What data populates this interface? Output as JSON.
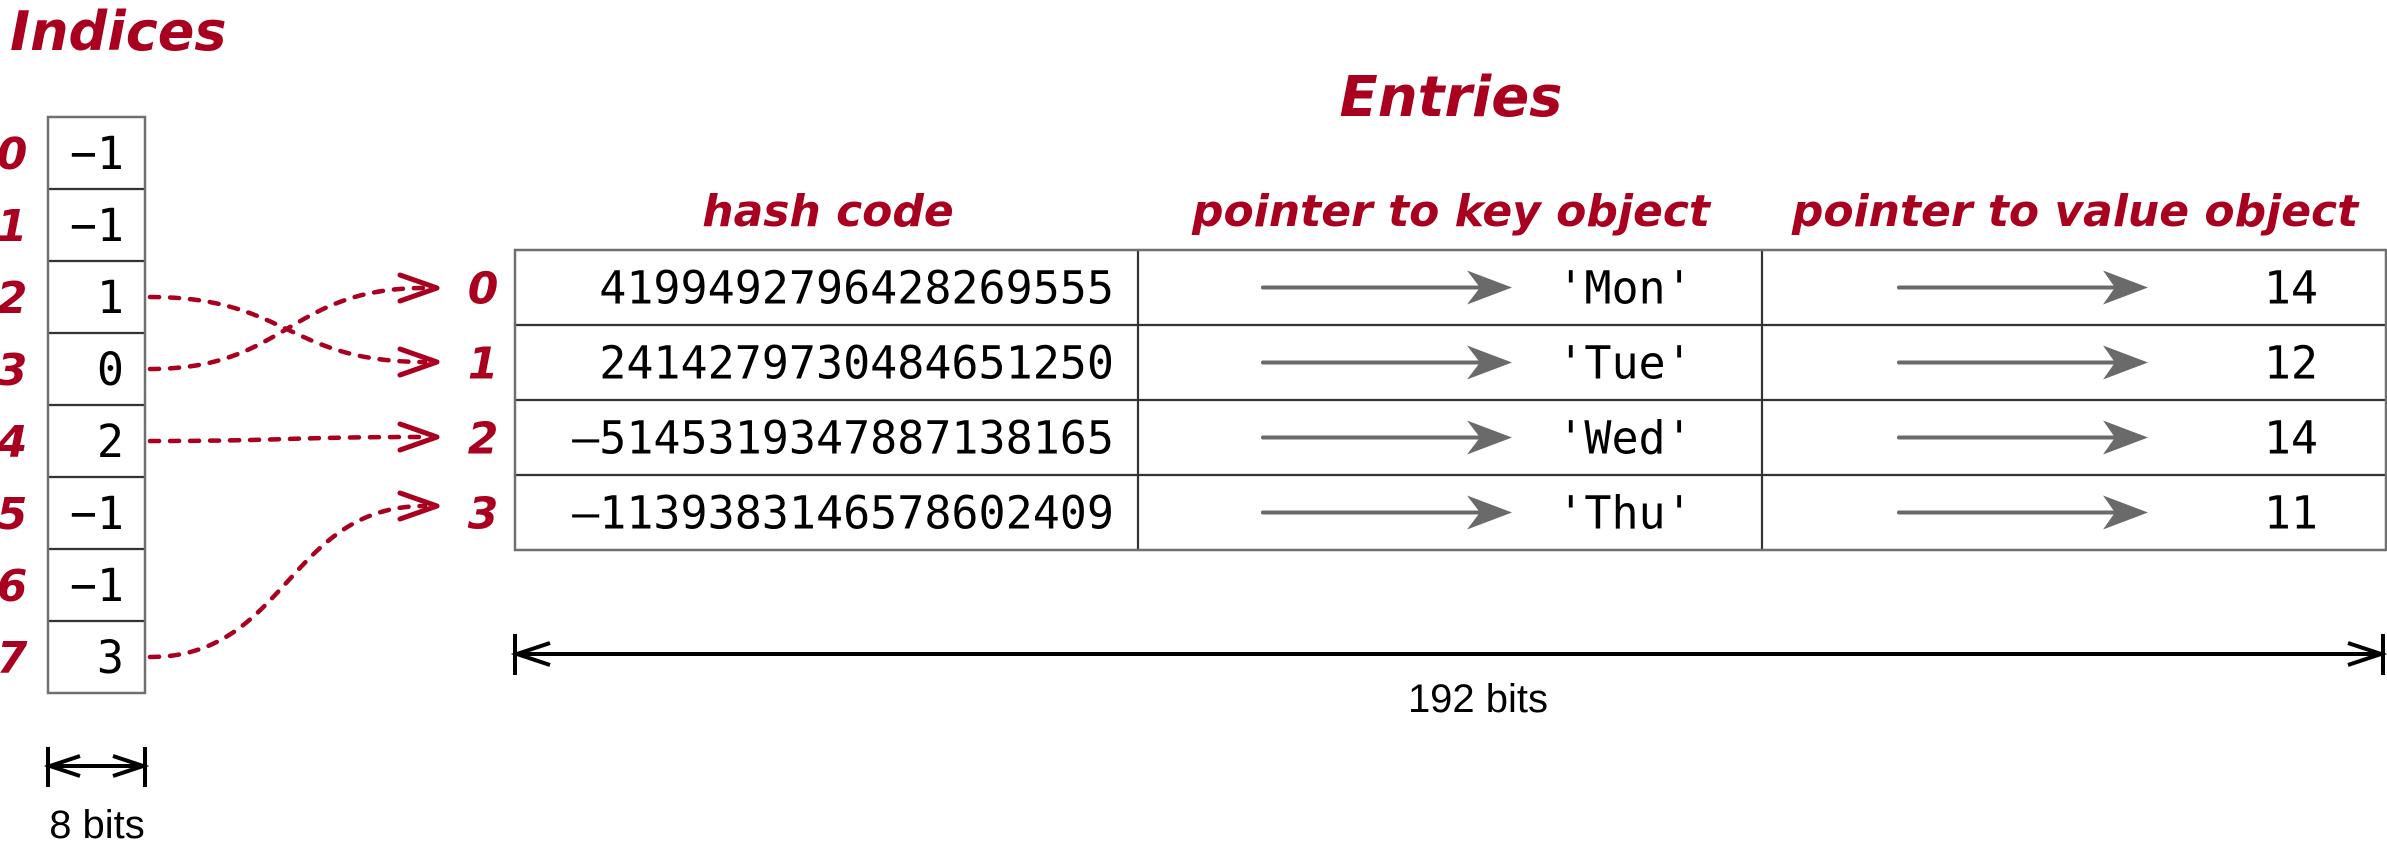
{
  "indices": {
    "title": "Indices",
    "row_labels": [
      "0",
      "1",
      "2",
      "3",
      "4",
      "5",
      "6",
      "7"
    ],
    "values": [
      "−1",
      "−1",
      "1",
      "0",
      "2",
      "−1",
      "−1",
      "3"
    ],
    "width_label": "8 bits"
  },
  "entries": {
    "title": "Entries",
    "columns": [
      "hash code",
      "pointer to key object",
      "pointer to value object"
    ],
    "row_labels": [
      "0",
      "1",
      "2",
      "3"
    ],
    "rows": [
      {
        "hash": "4199492796428269555",
        "key": "'Mon'",
        "value": "14"
      },
      {
        "hash": "2414279730484651250",
        "key": "'Tue'",
        "value": "12"
      },
      {
        "hash": "–5145319347887138165",
        "key": "'Wed'",
        "value": "14"
      },
      {
        "hash": "–1139383146578602409",
        "key": "'Thu'",
        "value": "11"
      }
    ],
    "width_label": "192 bits"
  },
  "links": [
    {
      "from_index": 2,
      "to_entry": 1
    },
    {
      "from_index": 3,
      "to_entry": 0
    },
    {
      "from_index": 4,
      "to_entry": 2
    },
    {
      "from_index": 7,
      "to_entry": 3
    }
  ],
  "colors": {
    "accent_red": "#A8001E",
    "pointer_gray": "#6a6a6a",
    "grid": "#333333"
  }
}
